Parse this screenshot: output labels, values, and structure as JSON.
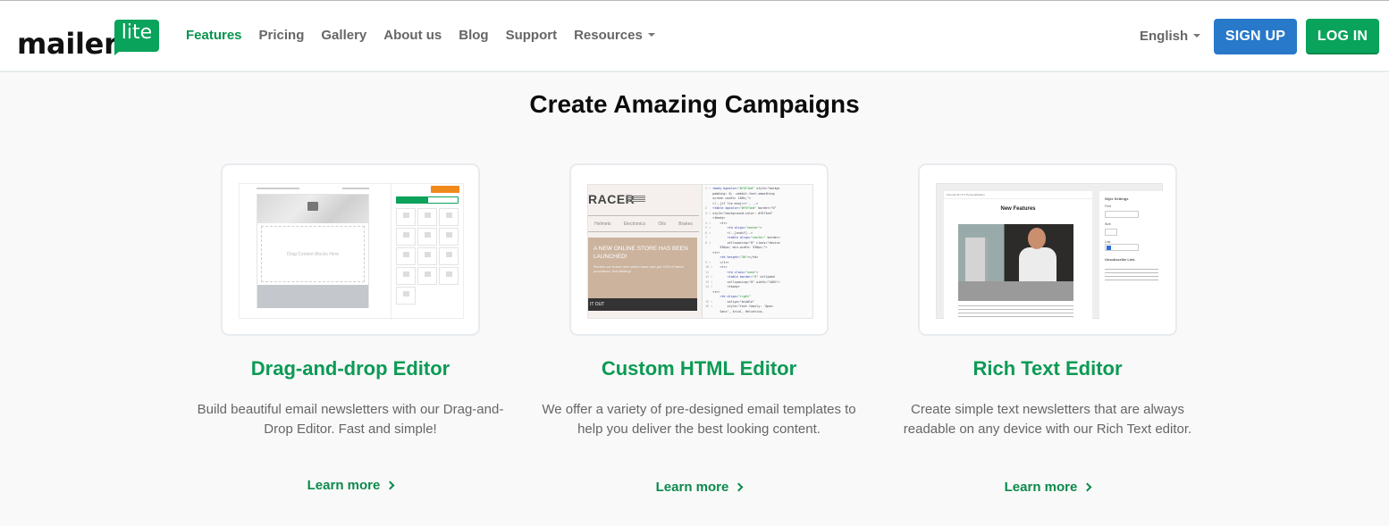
{
  "header": {
    "logo": {
      "word": "mailer",
      "badge": "lite"
    },
    "nav": [
      {
        "label": "Features",
        "active": true
      },
      {
        "label": "Pricing"
      },
      {
        "label": "Gallery"
      },
      {
        "label": "About us"
      },
      {
        "label": "Blog"
      },
      {
        "label": "Support"
      },
      {
        "label": "Resources",
        "dropdown": true
      }
    ],
    "language": "English",
    "signup_label": "SIGN UP",
    "login_label": "LOG IN"
  },
  "colors": {
    "brand_green": "#09a35b",
    "heading_green": "#0c9a55",
    "signup_blue": "#2879c9",
    "background": "#f9f9f9"
  },
  "section": {
    "title": "Create Amazing Campaigns",
    "cards": [
      {
        "title": "Drag-and-drop Editor",
        "description": "Build beautiful email newsletters with our Drag-and-Drop Editor. Fast and simple!",
        "link": "Learn more",
        "thumbnail": {
          "drop_text": "Drag Content Blocks Here"
        }
      },
      {
        "title": "Custom HTML Editor",
        "description": "We offer a variety of pre-designed email templates to help you deliver the best looking content.",
        "link": "Learn more",
        "thumbnail": {
          "brand": "RACER",
          "menu": [
            "Helmets",
            "Electronics",
            "Oils",
            "Brakes"
          ],
          "promo_title": "A NEW ONLINE STORE HAS BEEN LAUNCHED!",
          "promo_text": "Review our brand new online store and get 10% of future purchases. Not kidding!",
          "cta": "IT OUT"
        }
      },
      {
        "title": "Rich Text Editor",
        "description": "Create simple text newsletters that are always readable on any device with our Rich Text editor.",
        "link": "Learn more",
        "thumbnail": {
          "heading": "New Features",
          "toolbar_text": "Formats  B I S U  Personalization",
          "panel_title": "Style Settings",
          "panel_labels": [
            "Font",
            "Size",
            "Link",
            "Unsubscribe Link"
          ]
        }
      }
    ]
  }
}
